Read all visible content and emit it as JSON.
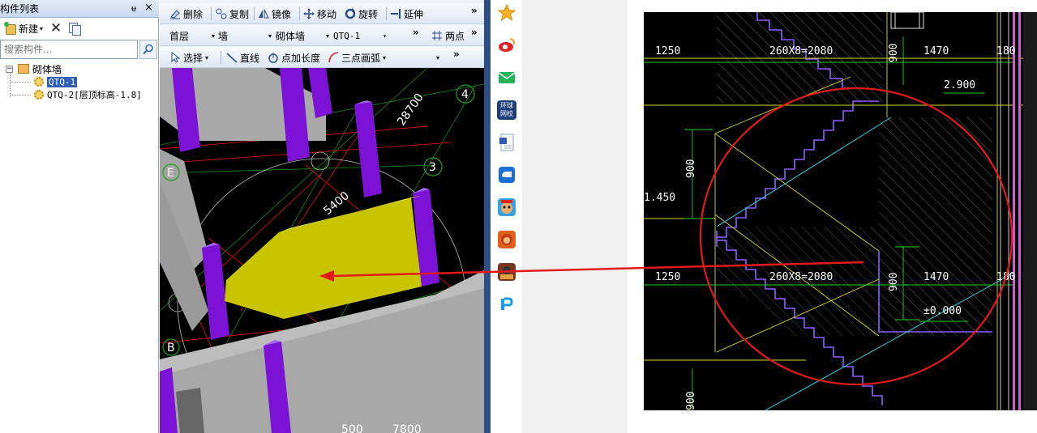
{
  "left_panel": {
    "title": "构件列表",
    "pin_glyph": "ᵾ",
    "close_glyph": "×",
    "new_label": "新建",
    "search_placeholder": "搜索构件...",
    "tree": {
      "root_label": "砌体墙",
      "toggle_glyph": "−",
      "items": [
        {
          "label": "QTQ-1",
          "selected": true
        },
        {
          "label": "QTQ-2[层顶标高-1.8]",
          "selected": false
        }
      ]
    }
  },
  "toolbar1": {
    "delete": "删除",
    "copy": "复制",
    "mirror": "镜像",
    "move": "移动",
    "rotate": "旋转",
    "extend": "延伸"
  },
  "toolbar2": {
    "floor": "首层",
    "type": "墙",
    "subtype": "砌体墙",
    "component": "QTQ-1",
    "two_points": "两点"
  },
  "toolbar3": {
    "select": "选择",
    "line": "直线",
    "point_length": "点加长度",
    "three_point_arc": "三点画弧"
  },
  "viewport": {
    "axis_labels": [
      "4",
      "3",
      "E",
      "B"
    ],
    "dimensions": [
      "28700",
      "5400",
      "500",
      "7800"
    ],
    "wall_color": "#a9a9a9",
    "column_color": "#7b12d6",
    "highlight_color": "#c8c400"
  },
  "taskbar_icons": [
    "star-icon",
    "weibo-icon",
    "mail-icon",
    "news-icon",
    "document-icon",
    "chat-icon",
    "game-icon-1",
    "game-icon-2",
    "game-icon-3",
    "pdf-reader-icon"
  ],
  "taskbar_news_text": "环球\n网校",
  "cad": {
    "dims": [
      "1250",
      "260X8=2080",
      "900",
      "1470",
      "180",
      "2.900",
      "900",
      "1.450",
      "1250",
      "260X8=2080",
      "900",
      "1470",
      "180",
      "±0.000",
      "900"
    ]
  },
  "more_glyph": "»",
  "dropdown_glyph": "▾"
}
